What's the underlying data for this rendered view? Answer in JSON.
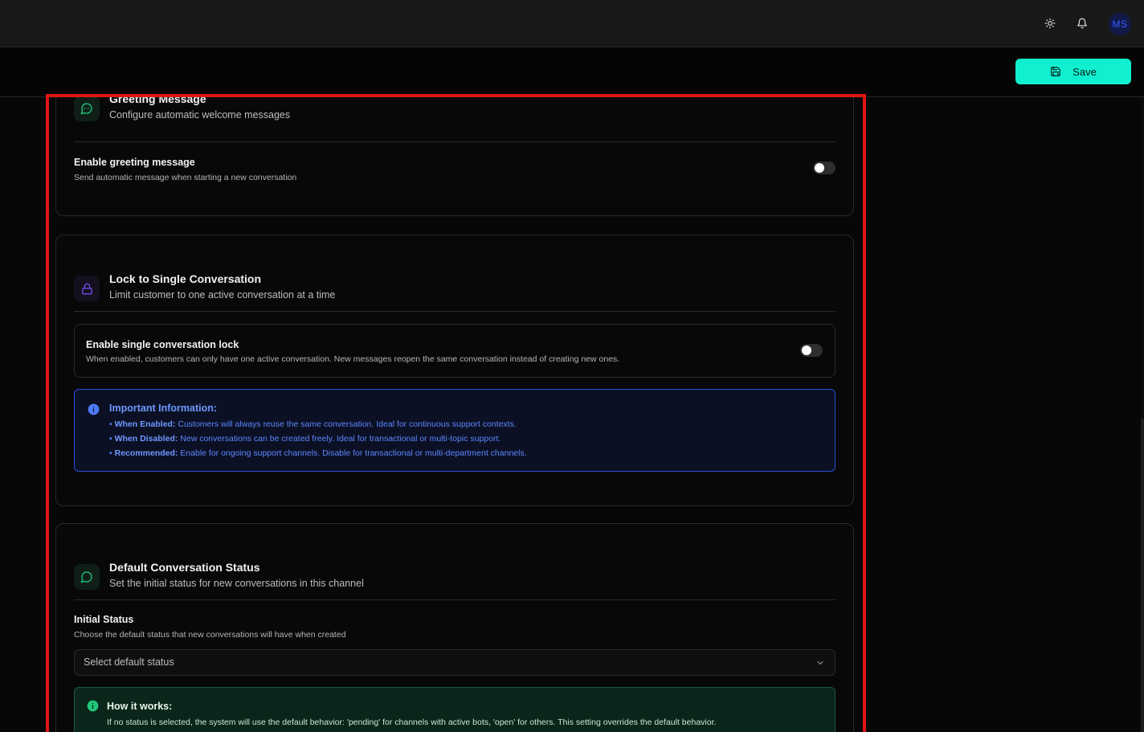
{
  "header": {
    "avatar_initials": "MS"
  },
  "toolbar": {
    "save_label": "Save"
  },
  "greeting": {
    "title": "Greeting Message",
    "subtitle": "Configure automatic welcome messages",
    "enable_label": "Enable greeting message",
    "enable_desc": "Send automatic message when starting a new conversation",
    "enabled": false
  },
  "lock": {
    "title": "Lock to Single Conversation",
    "subtitle": "Limit customer to one active conversation at a time",
    "enable_label": "Enable single conversation lock",
    "enable_desc": "When enabled, customers can only have one active conversation. New messages reopen the same conversation instead of creating new ones.",
    "enabled": false,
    "info_title": "Important Information:",
    "info_items": [
      {
        "bullet": "•",
        "label": "When Enabled:",
        "text": "Customers will always reuse the same conversation. Ideal for continuous support contexts."
      },
      {
        "bullet": "•",
        "label": "When Disabled:",
        "text": "New conversations can be created freely. Ideal for transactional or multi-topic support."
      },
      {
        "bullet": "•",
        "label": "Recommended:",
        "text": "Enable for ongoing support channels. Disable for transactional or multi-department channels."
      }
    ]
  },
  "status": {
    "title": "Default Conversation Status",
    "subtitle": "Set the initial status for new conversations in this channel",
    "field_label": "Initial Status",
    "field_desc": "Choose the default status that new conversations will have when created",
    "select_placeholder": "Select default status",
    "how_title": "How it works:",
    "how_text": "If no status is selected, the system will use the default behavior: 'pending' for channels with active bots, 'open' for others. This setting overrides the default behavior."
  },
  "colors": {
    "accent": "#10f0d0",
    "info_blue": "#6f98ff",
    "success_green": "#1c5a42",
    "highlight_red": "#e01515"
  },
  "icons": {
    "theme": "sun-icon",
    "notifications": "bell-icon",
    "save": "floppy-disk-icon",
    "greeting": "message-dots-icon",
    "lock": "lock-icon",
    "status": "message-circle-icon",
    "info": "info-icon",
    "dropdown": "chevron-down-icon"
  }
}
